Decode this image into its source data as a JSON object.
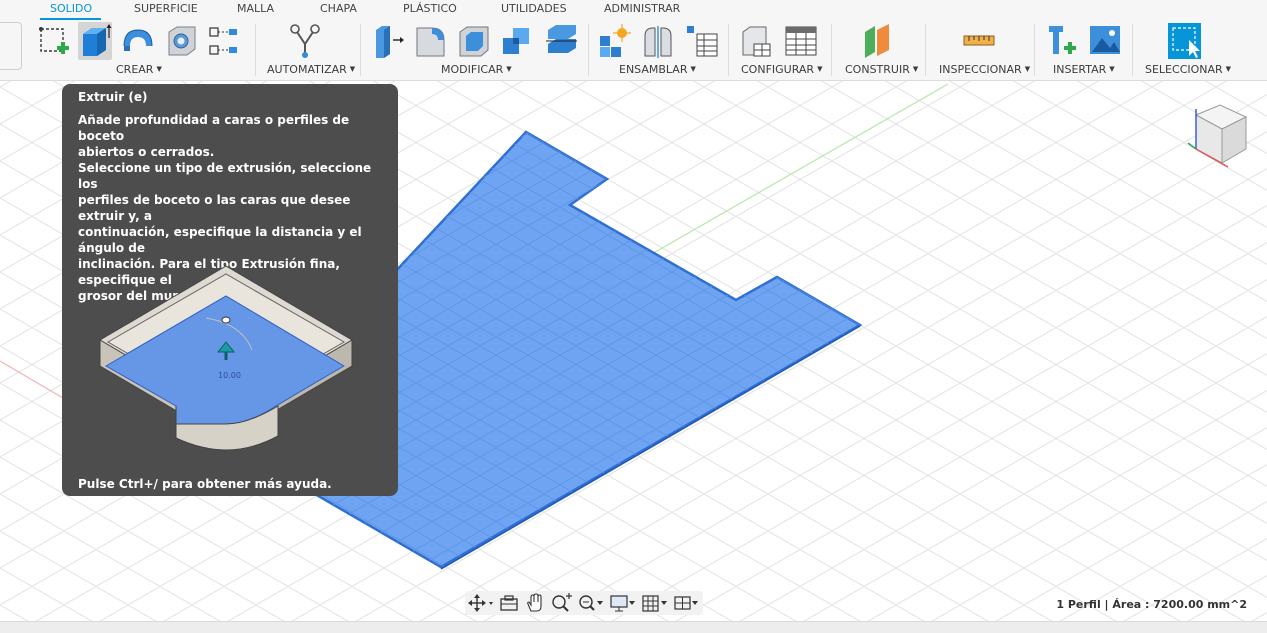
{
  "tabs": [
    "SOLIDO",
    "SUPERFICIE",
    "MALLA",
    "CHAPA",
    "PLÁSTICO",
    "UTILIDADES",
    "ADMINISTRAR"
  ],
  "active_tab": "SOLIDO",
  "groups": [
    "CREAR",
    "AUTOMATIZAR",
    "MODIFICAR",
    "ENSAMBLAR",
    "CONFIGURAR",
    "CONSTRUIR",
    "INSPECCIONAR",
    "INSERTAR",
    "SELECCIONAR"
  ],
  "tooltip": {
    "title": "Extruir (e)",
    "paragraph1": [
      "Añade profundidad a caras o perfiles de boceto",
      "abiertos o cerrados."
    ],
    "paragraph2": [
      "Seleccione un tipo de extrusión, seleccione los",
      "perfiles de boceto o las caras que desee extruir y, a",
      "continuación, especifique la distancia y el ángulo de",
      "inclinación. Para el tipo Extrusión fina, especifique el",
      "grosor del muro."
    ],
    "figure_value": "10.00",
    "footer": "Pulse Ctrl+/ para obtener más ayuda."
  },
  "status": "1 Perfil | Área : 7200.00 mm^2",
  "colors": {
    "accent": "#0696d7",
    "profile_fill": "#6fa4f2",
    "profile_edge": "#2f6fd0",
    "tooltip_bg": "#4d4d4d"
  },
  "icons": {
    "crear": [
      "sketch-icon",
      "extrude-icon",
      "revolve-icon",
      "hole-icon",
      "pattern-icon"
    ],
    "automatizar": [
      "automate-icon"
    ],
    "modificar": [
      "press-pull-icon",
      "fillet-icon",
      "shell-icon",
      "combine-icon",
      "align-icon"
    ],
    "ensamblar": [
      "new-component-icon",
      "joint-icon",
      "bom-icon"
    ],
    "configurar": [
      "config-icon",
      "table-icon"
    ],
    "construir": [
      "plane-icon"
    ],
    "inspeccionar": [
      "measure-icon"
    ],
    "insertar": [
      "insert-icon",
      "decal-icon"
    ],
    "seleccionar": [
      "select-icon"
    ],
    "navigation": [
      "orbit-icon",
      "look-at-icon",
      "pan-icon",
      "zoom-icon",
      "fit-icon",
      "display-icon",
      "grid-icon",
      "viewports-icon"
    ]
  }
}
